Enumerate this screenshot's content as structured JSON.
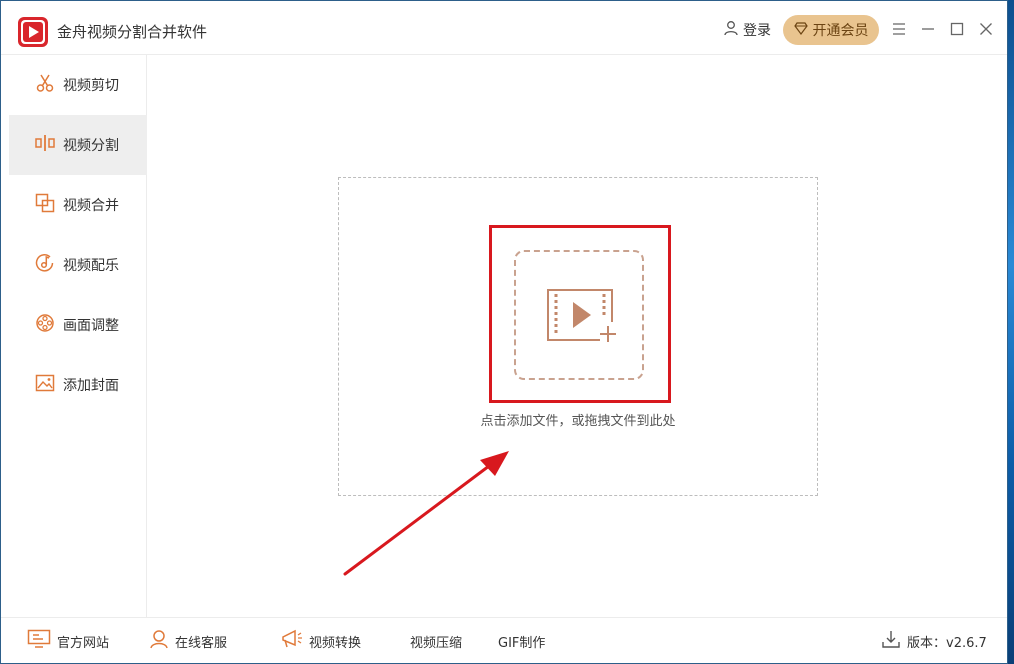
{
  "app": {
    "title": "金舟视频分割合并软件",
    "accent_color": "#d9262c",
    "icon_accent": "#e07a3a"
  },
  "header": {
    "login_label": "登录",
    "vip_label": "开通会员",
    "vip_color": "#e9c48f",
    "controls": [
      "menu-icon",
      "minimize-icon",
      "maximize-icon",
      "close-icon"
    ]
  },
  "sidebar": {
    "items": [
      {
        "label": "视频剪切",
        "icon": "scissors-icon",
        "active": false
      },
      {
        "label": "视频分割",
        "icon": "split-icon",
        "active": true
      },
      {
        "label": "视频合并",
        "icon": "merge-icon",
        "active": false
      },
      {
        "label": "视频配乐",
        "icon": "music-icon",
        "active": false
      },
      {
        "label": "画面调整",
        "icon": "film-reel-icon",
        "active": false
      },
      {
        "label": "添加封面",
        "icon": "image-icon",
        "active": false
      }
    ]
  },
  "main": {
    "drop_hint": "点击添加文件，或拖拽文件到此处",
    "add_icon": "add-video-icon",
    "highlight_color": "#d8181e"
  },
  "footer": {
    "items": [
      {
        "label": "官方网站",
        "icon": "monitor-icon"
      },
      {
        "label": "在线客服",
        "icon": "support-icon"
      },
      {
        "label": "视频转换",
        "icon": "megaphone-icon"
      },
      {
        "label": "视频压缩",
        "icon": ""
      },
      {
        "label": "GIF制作",
        "icon": ""
      }
    ],
    "version_label": "版本：v2.6.7",
    "download_icon": "download-icon"
  }
}
